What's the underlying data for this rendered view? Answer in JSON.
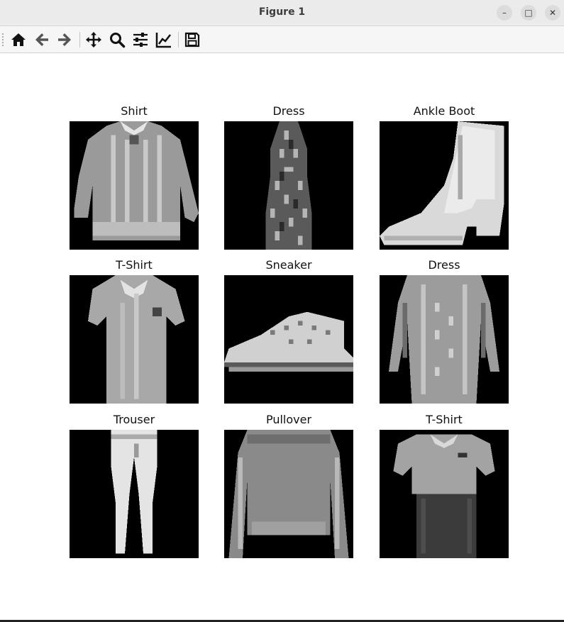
{
  "window": {
    "title": "Figure 1",
    "minimize_glyph": "–",
    "maximize_glyph": "□",
    "close_glyph": "✕"
  },
  "toolbar": {
    "icons": [
      "home-icon",
      "back-arrow-icon",
      "forward-arrow-icon",
      "pan-move-icon",
      "zoom-magnifier-icon",
      "configure-subplots-icon",
      "edit-axis-icon",
      "save-floppy-icon"
    ]
  },
  "figure": {
    "panels": [
      {
        "label": "Shirt"
      },
      {
        "label": "Dress"
      },
      {
        "label": "Ankle Boot"
      },
      {
        "label": "T-Shirt"
      },
      {
        "label": "Sneaker"
      },
      {
        "label": "Dress"
      },
      {
        "label": "Trouser"
      },
      {
        "label": "Pullover"
      },
      {
        "label": "T-Shirt"
      }
    ],
    "colormap": "gray",
    "background": "#000000"
  }
}
